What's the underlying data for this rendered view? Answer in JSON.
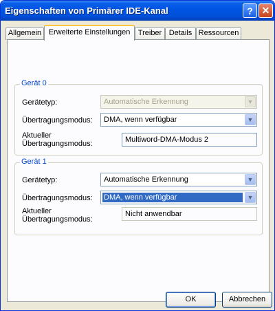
{
  "window": {
    "title": "Eigenschaften von Primärer IDE-Kanal",
    "help_glyph": "?",
    "close_glyph": "✕"
  },
  "tabs": [
    {
      "label": "Allgemein",
      "active": false
    },
    {
      "label": "Erweiterte Einstellungen",
      "active": true
    },
    {
      "label": "Treiber",
      "active": false
    },
    {
      "label": "Details",
      "active": false
    },
    {
      "label": "Ressourcen",
      "active": false
    }
  ],
  "device0": {
    "title": "Gerät 0",
    "type_label": "Gerätetyp:",
    "type_value": "Automatische Erkennung",
    "type_disabled": true,
    "mode_label": "Übertragungsmodus:",
    "mode_value": "DMA, wenn verfügbar",
    "current_label_line1": "Aktueller",
    "current_label_line2": "Übertragungsmodus:",
    "current_value": "Multiword-DMA-Modus 2"
  },
  "device1": {
    "title": "Gerät 1",
    "type_label": "Gerätetyp:",
    "type_value": "Automatische Erkennung",
    "mode_label": "Übertragungsmodus:",
    "mode_value": "DMA, wenn verfügbar",
    "mode_focused": true,
    "current_label_line1": "Aktueller",
    "current_label_line2": "Übertragungsmodus:",
    "current_value": "Nicht anwendbar"
  },
  "buttons": {
    "ok": "OK",
    "cancel": "Abbrechen"
  },
  "icons": {
    "dropdown_arrow": "chevron-down-icon"
  },
  "colors": {
    "title_bar": "#0054e3",
    "group_title": "#0046d5",
    "selection": "#316ac5",
    "active_tab_accent": "#ffc83c"
  }
}
